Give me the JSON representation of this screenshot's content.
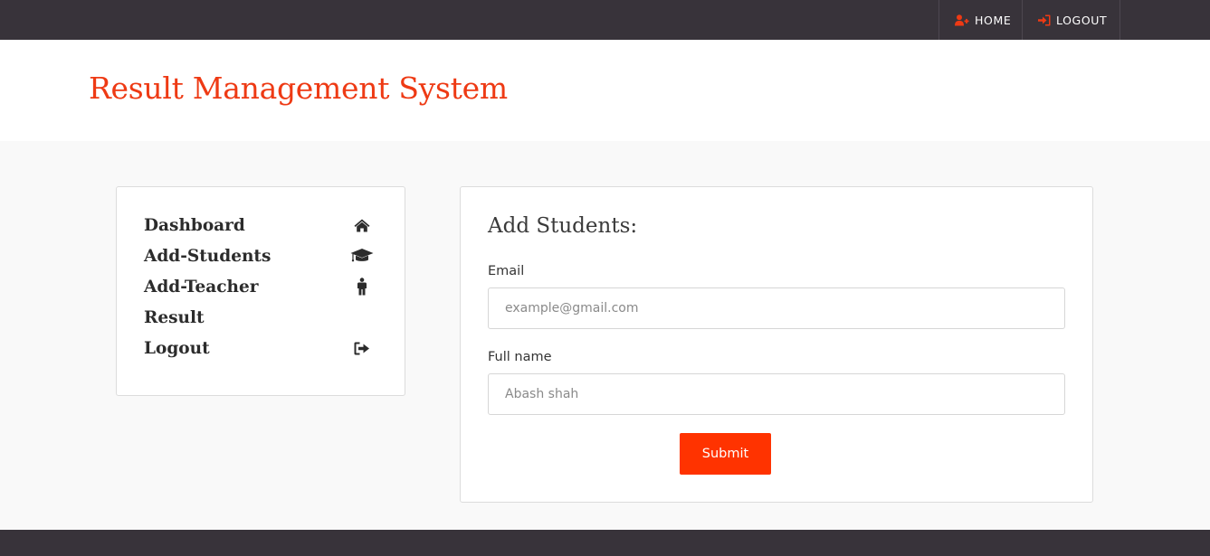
{
  "topnav": {
    "home_label": "HOME",
    "logout_label": "LOGOUT"
  },
  "header": {
    "title": "Result Management System"
  },
  "sidebar": {
    "items": [
      {
        "label": "Dashboard",
        "icon": "home-icon"
      },
      {
        "label": "Add-Students",
        "icon": "graduation-cap-icon"
      },
      {
        "label": "Add-Teacher",
        "icon": "person-icon"
      },
      {
        "label": "Result",
        "icon": ""
      },
      {
        "label": "Logout",
        "icon": "sign-out-icon"
      }
    ]
  },
  "form": {
    "title": "Add Students:",
    "email_label": "Email",
    "email_placeholder": "example@gmail.com",
    "fullname_label": "Full name",
    "fullname_placeholder": "Abash shah",
    "submit_label": "Submit"
  },
  "colors": {
    "accent": "#ff3300",
    "title": "#ee3a14",
    "topbar": "#38333a",
    "page_bg": "#f9f9f9"
  }
}
